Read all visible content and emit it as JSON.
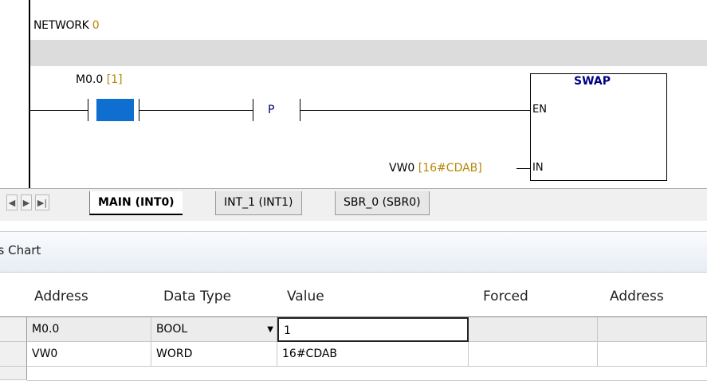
{
  "network": {
    "label": "NETWORK",
    "number": "0"
  },
  "contact": {
    "address": "M0.0",
    "value": "[1]"
  },
  "edge": {
    "label": "P"
  },
  "swap_box": {
    "title": "SWAP",
    "pin_en": "EN",
    "pin_in": "IN",
    "in_address": "VW0",
    "in_value": "[16#CDAB]"
  },
  "tabs": {
    "nav": [
      "◀",
      "▶",
      "▶|"
    ],
    "items": [
      {
        "label": "MAIN (INT0)",
        "active": true
      },
      {
        "label": "INT_1 (INT1)",
        "active": false
      },
      {
        "label": "SBR_0 (SBR0)",
        "active": false
      }
    ]
  },
  "status_chart": {
    "title": "us Chart"
  },
  "table": {
    "columns": [
      "Address",
      "Data Type",
      "Value",
      "Forced",
      "Address"
    ],
    "rows": [
      {
        "address": "M0.0",
        "data_type": "BOOL",
        "value": "1",
        "forced": "",
        "address2": ""
      },
      {
        "address": "VW0",
        "data_type": "WORD",
        "value": "16#CDAB",
        "forced": "",
        "address2": ""
      }
    ]
  },
  "colors": {
    "contact_fill": "#0f6fd1",
    "live_value": "#b8860b",
    "instruction": "#000080"
  }
}
